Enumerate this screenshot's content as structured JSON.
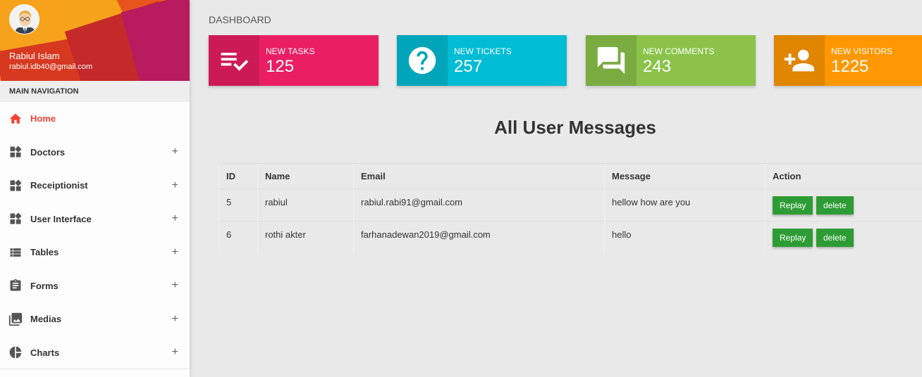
{
  "user": {
    "name": "Rabiul Islam",
    "email": "rabiul.idb40@gmail.com"
  },
  "nav": {
    "header": "MAIN NAVIGATION",
    "items": [
      {
        "label": "Home",
        "icon": "home-icon",
        "active": true
      },
      {
        "label": "Doctors",
        "icon": "widgets-icon"
      },
      {
        "label": "Receiptionist",
        "icon": "widgets-icon"
      },
      {
        "label": "User Interface",
        "icon": "widgets-icon"
      },
      {
        "label": "Tables",
        "icon": "list-icon"
      },
      {
        "label": "Forms",
        "icon": "assignment-icon"
      },
      {
        "label": "Medias",
        "icon": "photo-library-icon"
      },
      {
        "label": "Charts",
        "icon": "pie-chart-icon"
      }
    ],
    "expand_symbol": "+"
  },
  "page": {
    "title": "DASHBOARD"
  },
  "info_boxes": [
    {
      "label": "NEW TASKS",
      "value": "125",
      "icon": "playlist-check-icon",
      "color": "#e91e63"
    },
    {
      "label": "NEW TICKETS",
      "value": "257",
      "icon": "help-icon",
      "color": "#00bcd4"
    },
    {
      "label": "NEW COMMENTS",
      "value": "243",
      "icon": "forum-icon",
      "color": "#8bc34a"
    },
    {
      "label": "NEW VISITORS",
      "value": "1225",
      "icon": "person-add-icon",
      "color": "#ff9800"
    }
  ],
  "messages": {
    "title": "All User Messages",
    "columns": [
      "ID",
      "Name",
      "Email",
      "Message",
      "Action"
    ],
    "rows": [
      {
        "id": "5",
        "name": "rabiul",
        "email": "rabiul.rabi91@gmail.com",
        "message": "hellow how are you"
      },
      {
        "id": "6",
        "name": "rothi akter",
        "email": "farhanadewan2019@gmail.com",
        "message": "hello"
      }
    ],
    "replay_label": "Replay",
    "delete_label": "delete"
  }
}
